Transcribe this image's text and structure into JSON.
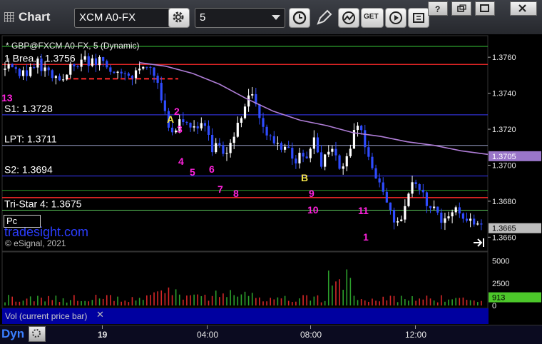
{
  "toolbar": {
    "title": "Chart",
    "symbol": "XCM A0-FX",
    "interval": "5",
    "get_label": "GET"
  },
  "chart_header": "* GBP@FXCM A0-FX, 5 (Dynamic)",
  "levels": [
    {
      "label": "1 Brea..: 1.3756",
      "value": 1.3756,
      "color": "#ff2a2a"
    },
    {
      "label": "S1: 1.3728",
      "value": 1.3728,
      "color": "#3a3aff"
    },
    {
      "label": "LPT: 1.3711",
      "value": 1.3711,
      "color": "#9aa0c8"
    },
    {
      "label": "S2: 1.3694",
      "value": 1.3694,
      "color": "#3a3aff"
    },
    {
      "label": "Tri-Star 4: 1.3675",
      "value": 1.3675,
      "color": "#5ac85a"
    }
  ],
  "watermark": "tradesight.com",
  "copyright": "© eSignal, 2021",
  "tag_box": "Pc",
  "price_axis": {
    "ticks": [
      "1.3760",
      "1.3740",
      "1.3720",
      "1.3700",
      "1.3680",
      "1.3660"
    ],
    "ma_tag": "1.3705",
    "last_tag": "1.3665"
  },
  "volume_axis": {
    "ticks": [
      "5000",
      "2500",
      "0"
    ],
    "current": "913"
  },
  "volume_label": "Vol (current price bar)",
  "time_axis": [
    "19",
    "04:00",
    "08:00",
    "12:00"
  ],
  "dyn_label": "Dyn",
  "annotations": [
    "13",
    "A",
    "2",
    "3",
    "4",
    "5",
    "6",
    "7",
    "8",
    "B",
    "9",
    "10",
    "11",
    "1"
  ],
  "colors": {
    "up": "#ffffff",
    "down": "#2f4cff",
    "ma": "#b07ed8",
    "seq": "#ff22dd",
    "green": "#2e9e2e"
  },
  "chart_data": {
    "type": "candlestick",
    "title": "* GBP@FXCM A0-FX, 5 (Dynamic)",
    "ylim": [
      1.3653,
      1.3768
    ],
    "close_path": [
      1.3753,
      1.3756,
      1.3752,
      1.375,
      1.3755,
      1.3757,
      1.3752,
      1.3751,
      1.3748,
      1.375,
      1.3753,
      1.3756,
      1.3758,
      1.3757,
      1.3756,
      1.3758,
      1.3755,
      1.3753,
      1.3752,
      1.3751,
      1.3749,
      1.3752,
      1.3755,
      1.3754,
      1.374,
      1.3728,
      1.3718,
      1.3723,
      1.3726,
      1.372,
      1.3718,
      1.3724,
      1.3708,
      1.3712,
      1.3705,
      1.3714,
      1.3722,
      1.3728,
      1.3742,
      1.3734,
      1.3722,
      1.3718,
      1.3712,
      1.3706,
      1.3712,
      1.3701,
      1.3708,
      1.3702,
      1.3715,
      1.37,
      1.3705,
      1.3708,
      1.37,
      1.3704,
      1.3715,
      1.3722,
      1.3708,
      1.3698,
      1.3694,
      1.368,
      1.3672,
      1.3668,
      1.3676,
      1.369,
      1.3692,
      1.3682,
      1.3678,
      1.3672,
      1.367,
      1.3674,
      1.3676,
      1.367,
      1.3668,
      1.3666,
      1.3665
    ],
    "ma_path": [
      1.3757,
      1.3755,
      1.3751,
      1.3745,
      1.3737,
      1.373,
      1.3725,
      1.3722,
      1.3718,
      1.3716,
      1.3713,
      1.3711,
      1.3708,
      1.3706
    ],
    "volume_max": 6000,
    "volume_seed": 913
  }
}
